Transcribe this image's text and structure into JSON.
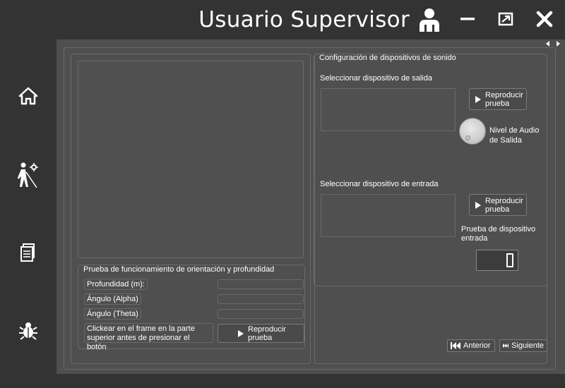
{
  "window": {
    "title": "Usuario Supervisor"
  },
  "sidebar": {
    "items": [
      {
        "icon": "home-icon"
      },
      {
        "icon": "blind-person-settings-icon"
      },
      {
        "icon": "documents-icon"
      },
      {
        "icon": "bug-icon"
      }
    ]
  },
  "orientation_test": {
    "title": "Prueba de funcionamiento de orientación y profundidad",
    "depth_label": "Profundidad (m):",
    "depth_value": "",
    "alpha_label": "Ángulo (Alpha)",
    "alpha_value": "",
    "theta_label": "Ángulo (Theta)",
    "theta_value": "",
    "instruction": "Clickear en el frame en la parte superior antes de presionar el botón",
    "play_label": "Reproducir prueba"
  },
  "sound_config": {
    "title": "Configuración de dispositivos de sonido",
    "output_label": "Seleccionar dispositivo de salida",
    "output_play_label": "Reproducir prueba",
    "output_level_label": "Nivel de Audio de Salida",
    "input_label": "Seleccionar dispositivo de entrada",
    "input_play_label": "Reproducir prueba",
    "input_test_label": "Prueba de dispositivo entrada",
    "input_level_display": "0"
  },
  "navigation": {
    "previous_label": "Anterior",
    "next_label": "Siguiente"
  },
  "colors": {
    "background": "#333333",
    "panel": "#4f4f4f",
    "border": "#6a6a6a",
    "text": "#ffffff"
  }
}
